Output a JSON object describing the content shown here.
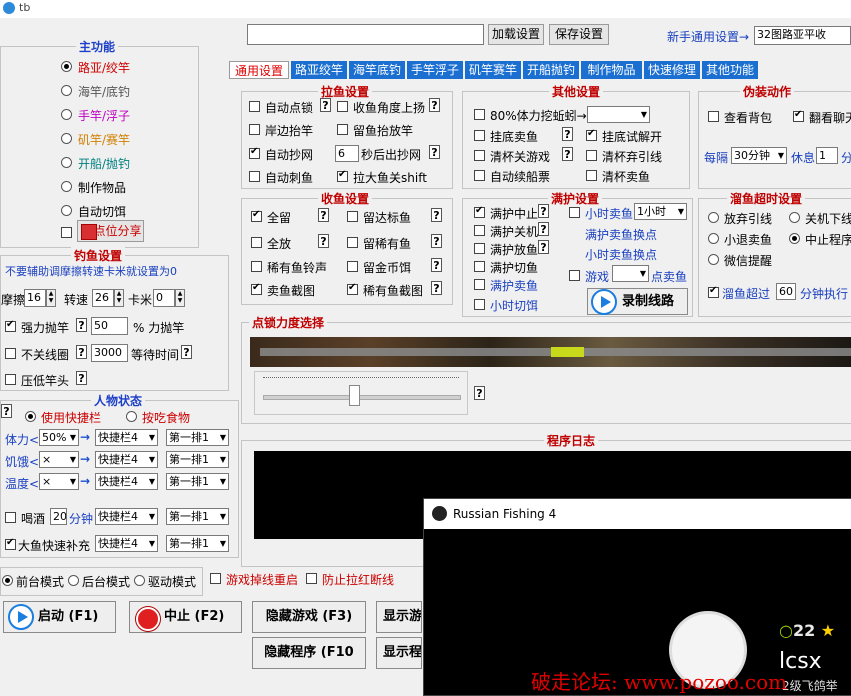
{
  "window": {
    "title": "tb"
  },
  "top": {
    "load_btn": "加载设置",
    "save_btn": "保存设置",
    "newbie_label": "新手通用设置→",
    "newbie_value": "32图路亚平收"
  },
  "tabs": [
    "通用设置",
    "路亚绞竿",
    "海竿底钓",
    "手竿浮子",
    "矶竿赛竿",
    "开船抛钓",
    "制作物品",
    "快速修理",
    "其他功能"
  ],
  "main_func": {
    "title": "主功能",
    "items": [
      {
        "label": "路亚/绞竿",
        "color": "#d00000"
      },
      {
        "label": "海竿/底钓",
        "color": "#555555"
      },
      {
        "label": "手竿/浮子",
        "color": "#c000c0"
      },
      {
        "label": "矶竿/赛竿",
        "color": "#d08000"
      },
      {
        "label": "开船/抛钓",
        "color": "#008080"
      },
      {
        "label": "制作物品",
        "color": "#000000"
      },
      {
        "label": "自动切饵",
        "color": "#000000"
      }
    ],
    "share_btn": "点位分享"
  },
  "fishing": {
    "title": "钓鱼设置",
    "hint": "不要辅助调摩擦转速卡米就设置为0",
    "friction_label": "摩擦",
    "friction_value": "16",
    "speed_label": "转速",
    "speed_value": "26",
    "kami_label": "卡米",
    "kami_value": "0",
    "force_label": "强力抛竿",
    "force_value": "50",
    "force_unit": "% 力抛竿",
    "nowheel_label": "不关线圈",
    "nowheel_value": "3000",
    "wait_label": "等待时间",
    "press_label": "压低竿头"
  },
  "char": {
    "title": "人物状态",
    "use_bar": "使用快捷栏",
    "eat": "按吃食物",
    "rows": [
      {
        "label": "体力<",
        "pct": "50%",
        "bar": "快捷栏4",
        "row": "第一排1"
      },
      {
        "label": "饥饿<",
        "pct": "×",
        "bar": "快捷栏4",
        "row": "第一排1"
      },
      {
        "label": "温度<",
        "pct": "×",
        "bar": "快捷栏4",
        "row": "第一排1"
      }
    ],
    "drink_label": "喝酒",
    "drink_value": "20",
    "drink_unit": "分钟",
    "drink_bar": "快捷栏4",
    "drink_row": "第一排1",
    "bigfish_label": "大鱼快速补充",
    "bigfish_bar": "快捷栏4",
    "bigfish_row": "第一排1"
  },
  "pull": {
    "title": "拉鱼设置",
    "auto_hook": "自动点锁",
    "angle_up": "收鱼角度上扬",
    "shore_lift": "岸边抬竿",
    "rare_lift": "留鱼抬放竿",
    "auto_net": "自动抄网",
    "net_sec": "6",
    "net_after": "秒后出抄网",
    "auto_stab": "自动刺鱼",
    "pull_shift": "拉大鱼关shift"
  },
  "collect": {
    "title": "收鱼设置",
    "keep_all": "全留",
    "keep_target": "留达标鱼",
    "release_all": "全放",
    "keep_rare": "留稀有鱼",
    "rare_bell": "稀有鱼铃声",
    "keep_gold": "留金币饵",
    "sell_shot": "卖鱼截图",
    "rare_shot": "稀有鱼截图"
  },
  "other": {
    "title": "其他设置",
    "stamina_dig": "80%体力挖蚯蚓→",
    "sell_fish": "挂底卖鱼",
    "unhook": "挂底试解开",
    "clean_lure": "清杯关游戏",
    "clean_line": "清杯弃引线",
    "auto_renew": "自动续船票",
    "clean_sell": "清杯卖鱼"
  },
  "full": {
    "title": "满护设置",
    "stop": "满护中止",
    "hour_sell": "小时卖鱼",
    "hour_value": "1小时",
    "shutdown": "满护关机",
    "full_switch": "满护卖鱼换点",
    "release": "满护放鱼",
    "hour_switch": "小时卖鱼换点",
    "cut_bait": "满护切鱼",
    "game_label": "游戏",
    "spot_sell": "点卖鱼",
    "full_sell": "满护卖鱼",
    "hour_cut": "小时切饵",
    "record_btn": "录制线路"
  },
  "disguise": {
    "title": "伪装动作",
    "check_bag": "查看背包",
    "flip_chat": "翻看聊天",
    "every_label": "每隔",
    "every_value": "30分钟",
    "rest_label": "休息",
    "rest_value": "1",
    "rest_unit": "分"
  },
  "timeout": {
    "title": "溜鱼超时设置",
    "drop_line": "放弃引线",
    "shutdown": "关机下线",
    "small_sell": "小退卖鱼",
    "stop_prog": "中止程序",
    "wechat": "微信提醒",
    "over_label": "溜鱼超过",
    "over_value": "60",
    "over_unit": "分钟执行"
  },
  "strength": {
    "title": "点锁力度选择",
    "progress": 0.46
  },
  "log": {
    "title": "程序日志"
  },
  "modes": {
    "front": "前台模式",
    "back": "后台模式",
    "driver": "驱动模式",
    "restart": "游戏掉线重启",
    "prevent": "防止拉红断线"
  },
  "buttons": {
    "start": "启动 (F1)",
    "stop": "中止 (F2)",
    "hide_game": "隐藏游戏 (F3)",
    "show_game": "显示游",
    "hide_prog": "隐藏程序 (F10",
    "show_prog": "显示程"
  },
  "overlay": {
    "title": "Russian Fishing 4",
    "level": "22",
    "name": "lcsx",
    "sub": "2级飞鸽举"
  },
  "watermark": "破走论坛: www.pozoo.com"
}
